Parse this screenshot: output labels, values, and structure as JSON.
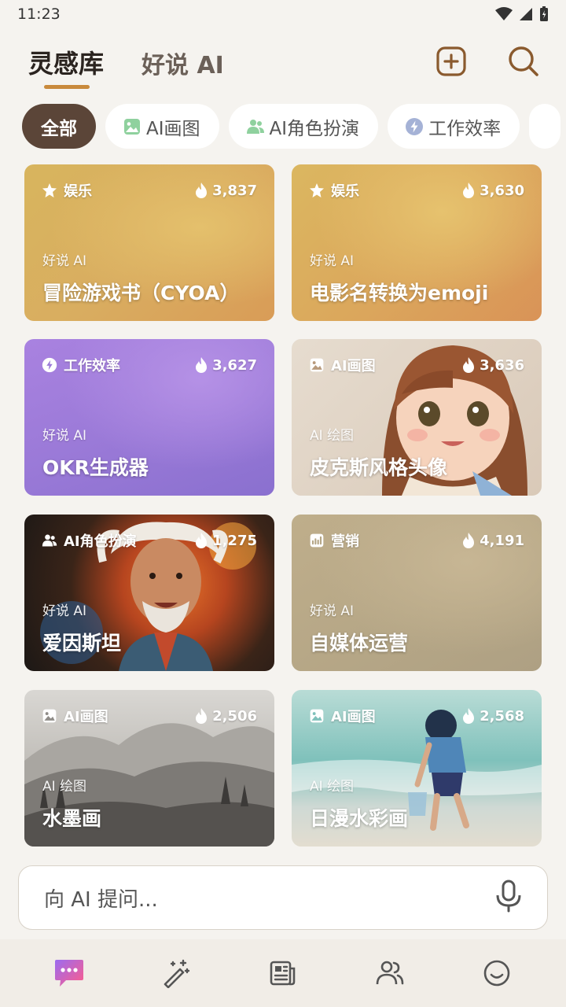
{
  "status": {
    "time": "11:23"
  },
  "header": {
    "tab_active": "灵感库",
    "tab_other": "好说 AI"
  },
  "chips": [
    {
      "label": "全部",
      "icon": "none",
      "active": true
    },
    {
      "label": "AI画图",
      "icon": "image-icon",
      "active": false
    },
    {
      "label": "AI角色扮演",
      "icon": "people-icon",
      "active": false
    },
    {
      "label": "工作效率",
      "icon": "bolt-icon",
      "active": false
    }
  ],
  "cards": [
    {
      "tag": "娱乐",
      "tag_icon": "star-icon",
      "hot": "3,837",
      "source": "好说 AI",
      "title": "冒险游戏书（CYOA）",
      "theme": "gold"
    },
    {
      "tag": "娱乐",
      "tag_icon": "star-icon",
      "hot": "3,630",
      "source": "好说 AI",
      "title": "电影名转换为emoji",
      "theme": "gold2"
    },
    {
      "tag": "工作效率",
      "tag_icon": "bolt-icon",
      "hot": "3,627",
      "source": "好说 AI",
      "title": "OKR生成器",
      "theme": "purple"
    },
    {
      "tag": "AI画图",
      "tag_icon": "image-icon",
      "hot": "3,636",
      "source": "AI 绘图",
      "title": "皮克斯风格头像",
      "theme": "girl"
    },
    {
      "tag": "AI角色扮演",
      "tag_icon": "people-icon",
      "hot": "1,275",
      "source": "好说 AI",
      "title": "爱因斯坦",
      "theme": "einstein"
    },
    {
      "tag": "营销",
      "tag_icon": "chart-icon",
      "hot": "4,191",
      "source": "好说 AI",
      "title": "自媒体运营",
      "theme": "khaki"
    },
    {
      "tag": "AI画图",
      "tag_icon": "image-icon",
      "hot": "2,506",
      "source": "AI 绘图",
      "title": "水墨画",
      "theme": "ink"
    },
    {
      "tag": "AI画图",
      "tag_icon": "image-icon",
      "hot": "2,568",
      "source": "AI 绘图",
      "title": "日漫水彩画",
      "theme": "beach"
    }
  ],
  "ask": {
    "placeholder": "向 AI 提问..."
  },
  "nav": [
    "chat-icon",
    "magic-wand-icon",
    "news-icon",
    "people-icon",
    "smile-icon"
  ],
  "colors": {
    "accent": "#c98a3c",
    "active_chip": "#5b4538",
    "background": "#f5f3ef"
  }
}
